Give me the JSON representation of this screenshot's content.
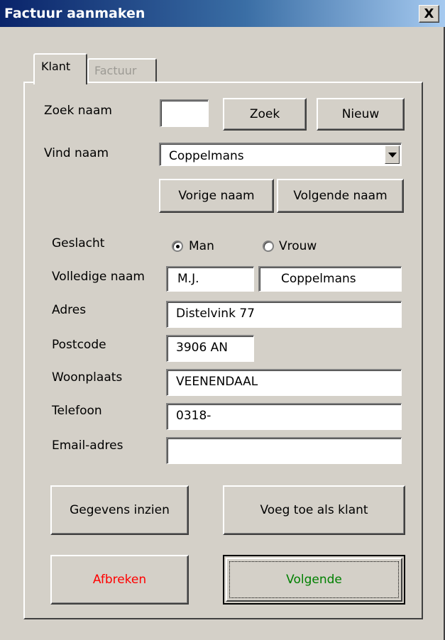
{
  "window": {
    "title": "Factuur aanmaken",
    "close_label": "X"
  },
  "tabs": [
    {
      "label": "Klant"
    },
    {
      "label": "Factuur"
    }
  ],
  "search": {
    "zoek_label": "Zoek naam",
    "zoek_value": "",
    "zoek_button": "Zoek",
    "nieuw_button": "Nieuw",
    "vind_label": "Vind naam",
    "vind_value": "Coppelmans",
    "prev_button": "Vorige naam",
    "next_button": "Volgende naam"
  },
  "form": {
    "geslacht_label": "Geslacht",
    "gender_options": [
      {
        "label": "Man",
        "selected": true
      },
      {
        "label": "Vrouw",
        "selected": false
      }
    ],
    "naam_label": "Volledige naam",
    "initials": "M.J.",
    "lastname": "Coppelmans",
    "adres_label": "Adres",
    "adres": "Distelvink 77",
    "postcode_label": "Postcode",
    "postcode": "3906 AN",
    "woonplaats_label": "Woonplaats",
    "woonplaats": "VEENENDAAL",
    "telefoon_label": "Telefoon",
    "telefoon": "0318-",
    "email_label": "Email-adres",
    "email": ""
  },
  "actions": {
    "gegevens_button": "Gegevens inzien",
    "voeg_button": "Voeg toe als klant",
    "afbreken_button": "Afbreken",
    "volgende_button": "Volgende"
  },
  "colors": {
    "afbreken_text": "#ff0000",
    "volgende_text": "#008000",
    "title_bar": "#0a246a"
  }
}
